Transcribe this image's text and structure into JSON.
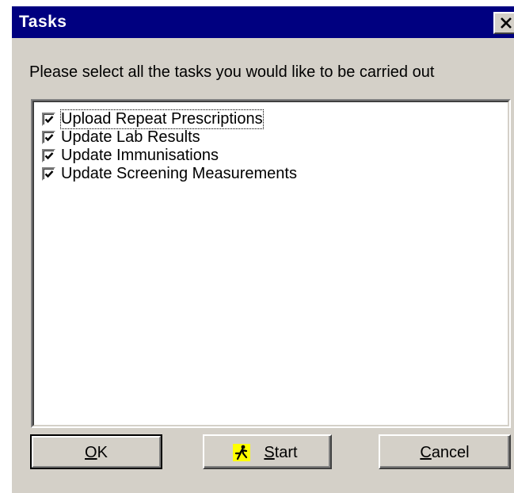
{
  "window": {
    "title": "Tasks",
    "close_icon": "close-x-icon"
  },
  "instruction": "Please select all the tasks you would like to be carried out",
  "tasks": [
    {
      "label": "Upload Repeat Prescriptions",
      "checked": true,
      "focused": true
    },
    {
      "label": "Update Lab Results",
      "checked": true,
      "focused": false
    },
    {
      "label": "Update Immunisations",
      "checked": true,
      "focused": false
    },
    {
      "label": "Update Screening Measurements",
      "checked": true,
      "focused": false
    }
  ],
  "buttons": {
    "ok": {
      "label_access": "O",
      "label_rest": "K"
    },
    "start": {
      "label_access": "S",
      "label_rest": "tart",
      "icon": "running-man-icon"
    },
    "cancel": {
      "label_access": "C",
      "label_rest": "ancel"
    }
  },
  "colors": {
    "titlebar": "#000080",
    "face": "#d4d0c8",
    "start_icon_bg": "#ffff00"
  }
}
